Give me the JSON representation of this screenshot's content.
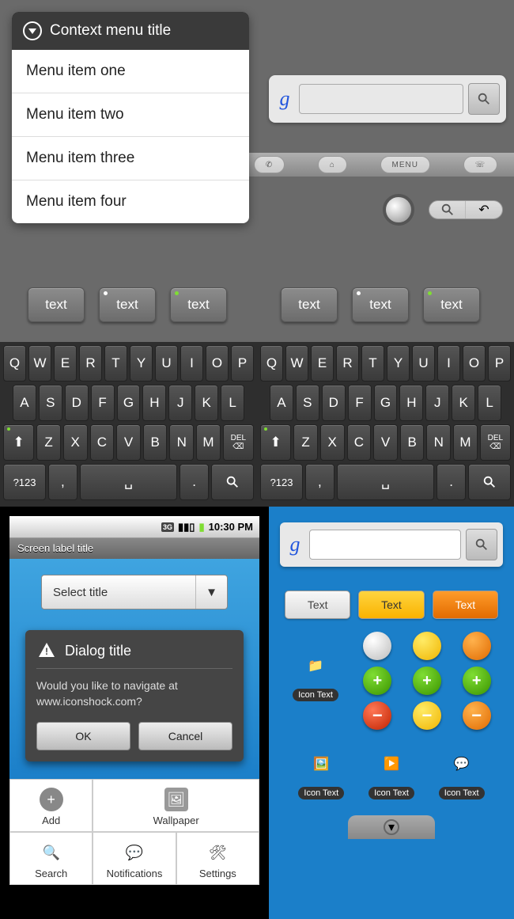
{
  "context_menu": {
    "title": "Context menu title",
    "items": [
      "Menu item one",
      "Menu item two",
      "Menu item three",
      "Menu item four"
    ]
  },
  "search": {
    "g": "g",
    "placeholder": ""
  },
  "hwbuttons": {
    "menu": "MENU"
  },
  "chips": [
    "text",
    "text",
    "text",
    "text",
    "text",
    "text"
  ],
  "keyboard": {
    "row1": [
      "Q",
      "W",
      "E",
      "R",
      "T",
      "Y",
      "U",
      "I",
      "O",
      "P"
    ],
    "row2": [
      "A",
      "S",
      "D",
      "F",
      "G",
      "H",
      "J",
      "K",
      "L"
    ],
    "row3": [
      "Z",
      "X",
      "C",
      "V",
      "B",
      "N",
      "M"
    ],
    "shift": "⇧",
    "del": "DEL",
    "sym": "?123",
    "comma": ",",
    "space": "⎵",
    "period": ".",
    "search": "🔍"
  },
  "statusbar": {
    "sig": "3G",
    "time": "10:30 PM"
  },
  "screen_title": "Screen label title",
  "select_title": "Select title",
  "dialog": {
    "title": "Dialog title",
    "body": "Would you like to navigate at www.iconshock.com?",
    "ok": "OK",
    "cancel": "Cancel"
  },
  "options_menu": [
    "Add",
    "Wallpaper",
    "Search",
    "Notifications",
    "Settings"
  ],
  "right_buttons": [
    "Text",
    "Text",
    "Text"
  ],
  "icon_text": "Icon Text"
}
